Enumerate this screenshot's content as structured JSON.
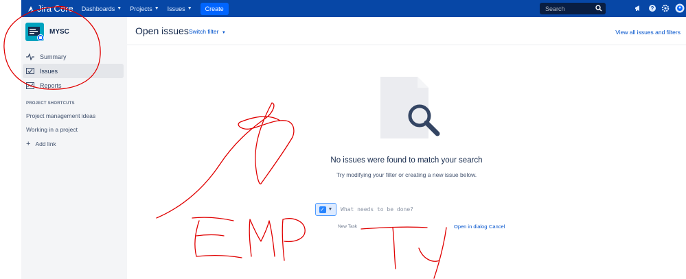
{
  "topbar": {
    "logo_text": "Jira Core",
    "nav": [
      {
        "label": "Dashboards"
      },
      {
        "label": "Projects"
      },
      {
        "label": "Issues"
      }
    ],
    "create_label": "Create",
    "search_placeholder": "Search",
    "icons": [
      "megaphone-icon",
      "help-icon",
      "settings-icon",
      "user-avatar"
    ]
  },
  "sidebar": {
    "project_name": "MYSC",
    "items": [
      {
        "label": "Summary",
        "icon": "summary-icon"
      },
      {
        "label": "Issues",
        "icon": "issues-icon",
        "active": true
      },
      {
        "label": "Reports",
        "icon": "reports-icon"
      }
    ],
    "shortcuts_title": "PROJECT SHORTCUTS",
    "shortcuts": [
      {
        "label": "Project management ideas"
      },
      {
        "label": "Working in a project"
      }
    ],
    "add_link": "Add link"
  },
  "main": {
    "title": "Open issues",
    "switch_filter": "Switch filter",
    "view_all": "View all issues and filters",
    "empty_title": "No issues were found to match your search",
    "empty_subtitle": "Try modifying your filter or creating a new issue below.",
    "create": {
      "placeholder": "What needs to be done?",
      "type_label": "New Task",
      "open_dialog": "Open in dialog",
      "cancel": "Cancel"
    }
  },
  "colors": {
    "topbar": "#0747a6",
    "link": "#0052cc",
    "annotation": "#e00000"
  }
}
